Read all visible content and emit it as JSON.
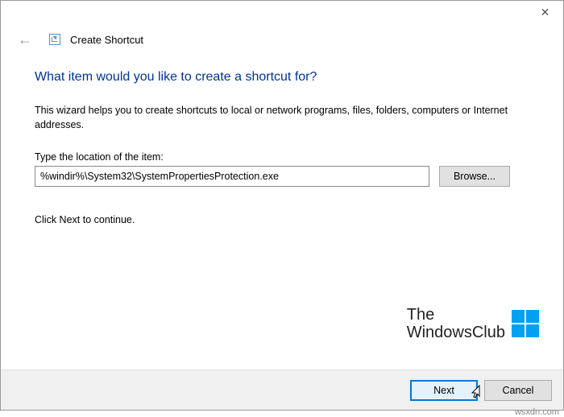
{
  "titlebar": {
    "close_glyph": "✕"
  },
  "header": {
    "back_glyph": "←",
    "title": "Create Shortcut"
  },
  "content": {
    "heading": "What item would you like to create a shortcut for?",
    "description": "This wizard helps you to create shortcuts to local or network programs, files, folders, computers or Internet addresses.",
    "field_label": "Type the location of the item:",
    "location_value": "%windir%\\System32\\SystemPropertiesProtection.exe",
    "browse_label": "Browse...",
    "continue_text": "Click Next to continue."
  },
  "watermark": {
    "line1": "The",
    "line2": "WindowsClub"
  },
  "footer": {
    "next_label": "Next",
    "cancel_label": "Cancel"
  },
  "attribution": "wsxdn.com"
}
